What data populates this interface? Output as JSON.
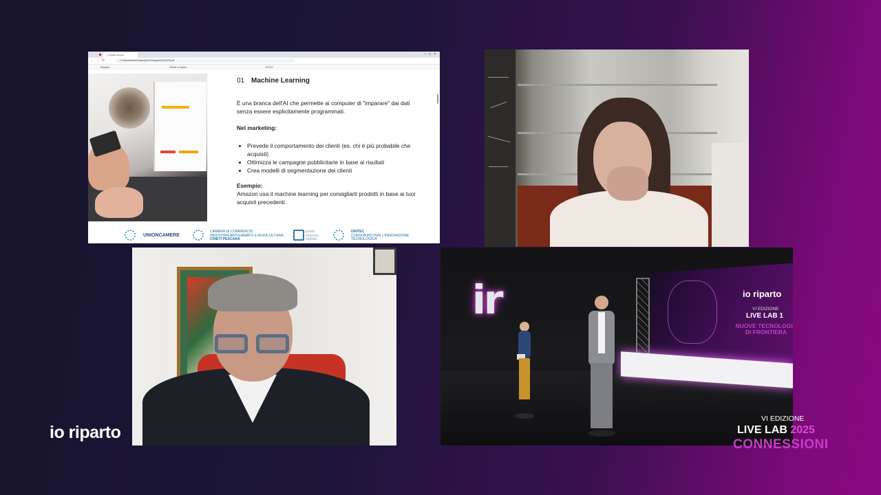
{
  "screen_share": {
    "browser": {
      "tab_title": "io Riparto AIH.pdf",
      "address": "C:/Users/utente/Desktop/io%20riparto%202025.pdf",
      "toolbar_draw": "Disegna",
      "toolbar_copilot": "Chiedi a Copilot",
      "page_counter": "8 di 12"
    },
    "slide": {
      "number": "01",
      "title": "Machine Learning",
      "intro": "È una branca dell'AI che permette ai computer di \"imparare\" dai dati senza essere esplicitamente programmati.",
      "marketing_heading": "Nel marketing:",
      "bullets": [
        "Prevede il comportamento dei clienti (es. chi è più probabile che acquisti)",
        "Ottimizza le campagne pubblicitarie in base ai risultati",
        "Crea modelli di segmentazione dei clienti"
      ],
      "example_heading": "Esempio:",
      "example_text": "Amazon usa il machine learning per consigliarti prodotti in base ai tuoi acquisti precedenti."
    },
    "footer_logos": {
      "unioncamere": "UNIONCAMERE",
      "camera_l1": "CAMERA DI COMMERCIO",
      "camera_l2": "INDUSTRIA ARTIGIANATO E AGRICOLTURA",
      "camera_l3": "CHIETI PESCARA",
      "pid_l1": "punto",
      "pid_l2": "impresa",
      "pid_l3": "digitale",
      "dintec_l1": "DINTEC",
      "dintec_l2": "CONSORZIO PER L'INNOVAZIONE",
      "dintec_l3": "TECNOLOGICA"
    }
  },
  "studio": {
    "logo": "ir",
    "wall_brand": "io riparto",
    "wall_edition": "VI EDIZIONE",
    "wall_livelab": "LIVE LAB 1",
    "wall_theme": "NUOVE TECNOLOGIE DI FRONTIERA"
  },
  "branding": {
    "left_logo": "io riparto",
    "edition": "VI EDIZIONE",
    "live_lab": "LIVE LAB",
    "year": "2025",
    "theme": "CONNESSIONI"
  },
  "colors": {
    "accent_magenta": "#c93cc8",
    "background_dark": "#17142c"
  }
}
